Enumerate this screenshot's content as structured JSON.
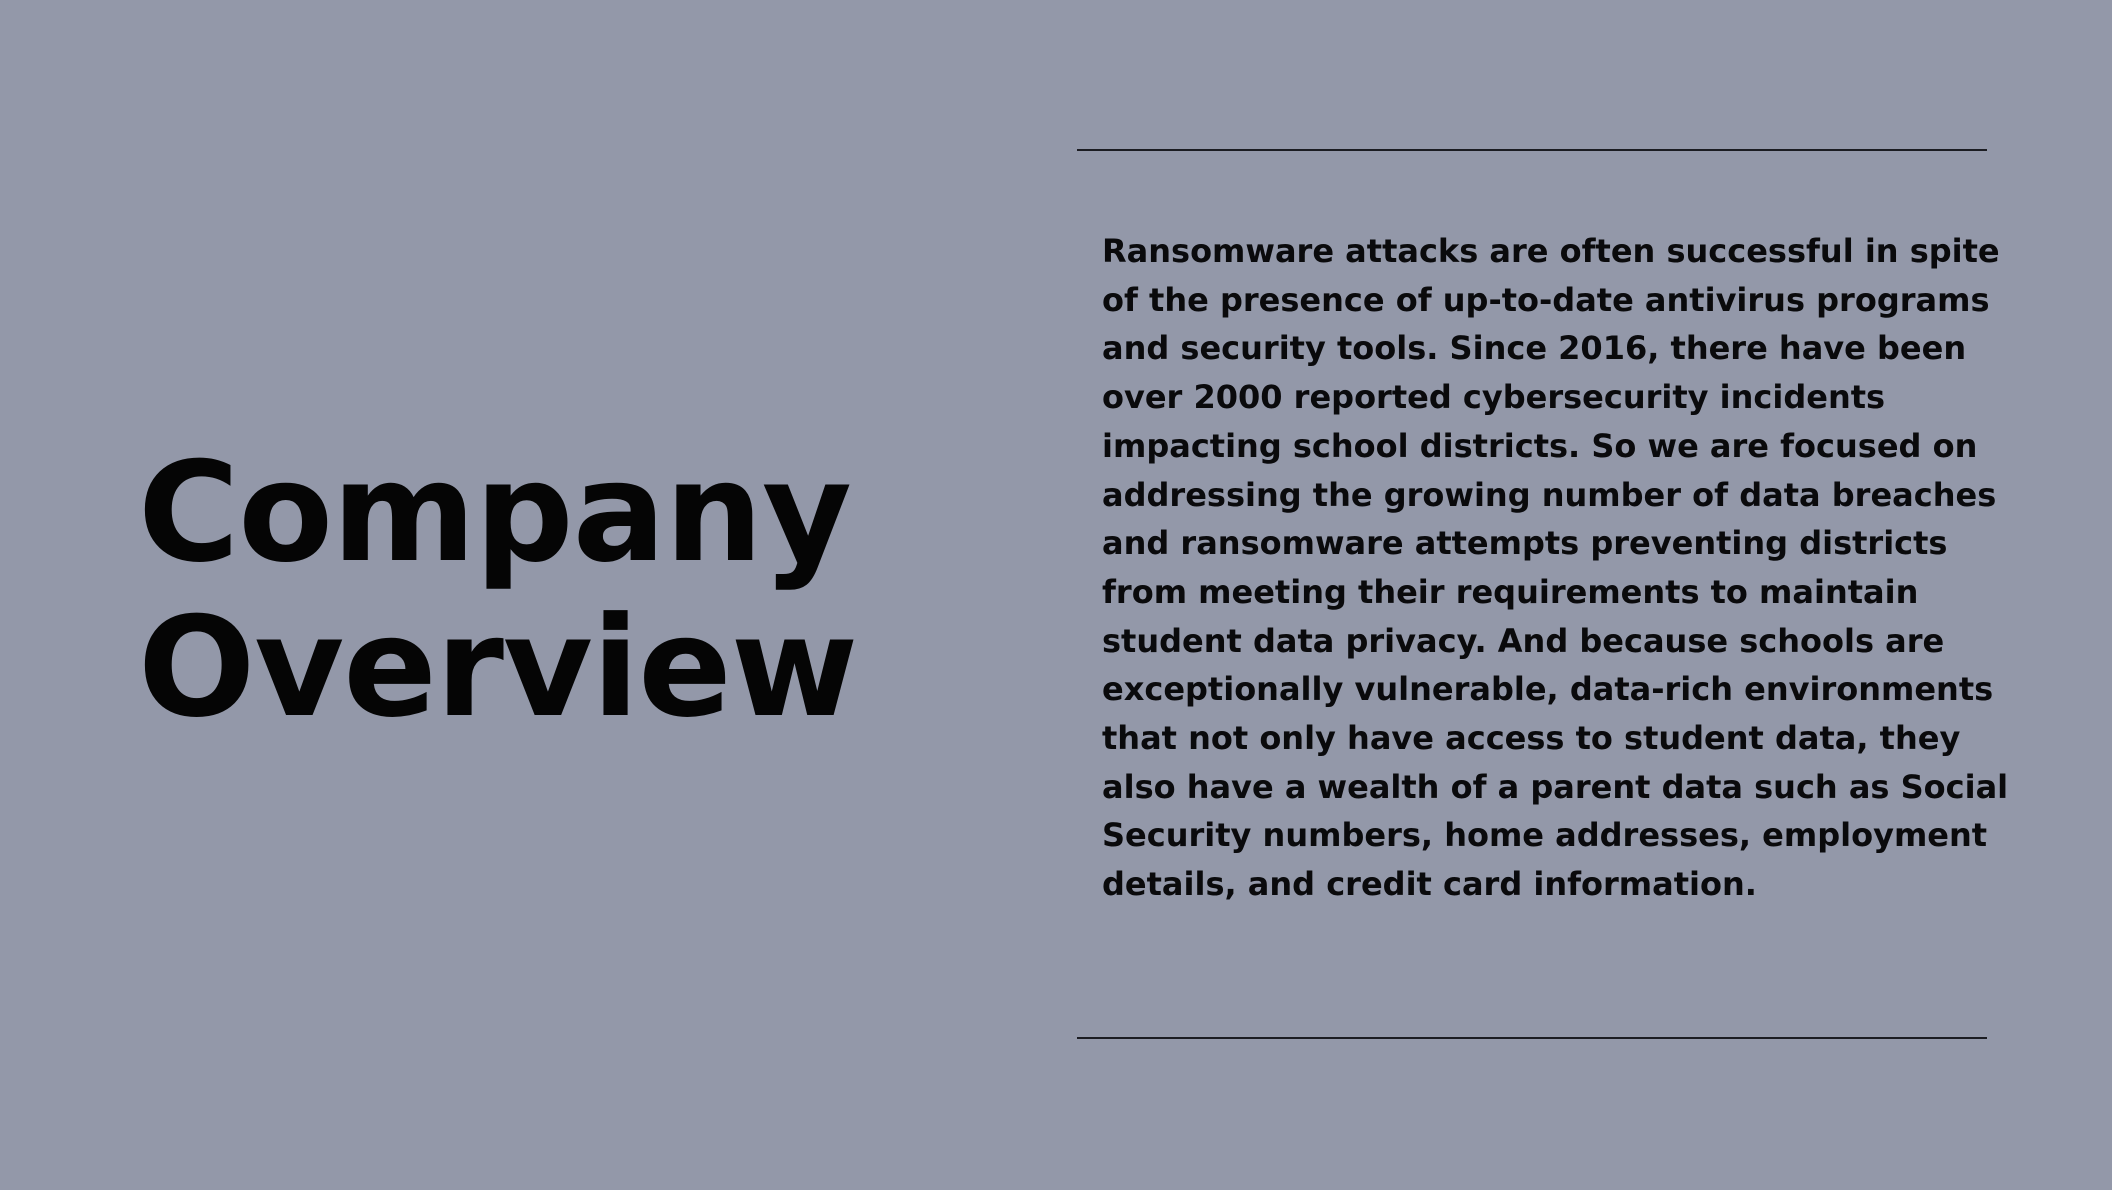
{
  "slide": {
    "title_line1": "Company",
    "title_line2": "Overview",
    "body": "Ransomware attacks are often successful in spite of the presence of up-to-date antivirus programs and security tools. Since 2016, there have been over 2000 reported cybersecurity incidents impacting school districts. So we are focused on addressing the growing number of data breaches and ransomware attempts preventing districts from meeting their requirements to maintain student data privacy. And because schools are exceptionally vulnerable, data-rich environments that not only have access to student data, they also have a wealth of a parent data such as Social Security numbers, home addresses, employment details, and credit card information."
  },
  "colors": {
    "background": "#9398a9",
    "text": "#050505",
    "rule": "#1b1c22"
  }
}
